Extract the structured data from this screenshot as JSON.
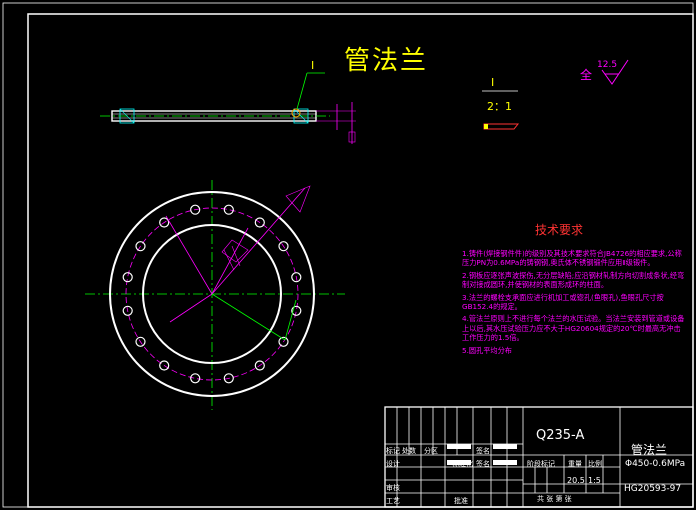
{
  "drawing": {
    "title": "管法兰",
    "detail_callout": "I",
    "detail_label": "I",
    "detail_scale": "2：1",
    "roughness_prefix": "全",
    "roughness_value": "12.5"
  },
  "tech_requirements": {
    "title": "技术要求",
    "items": [
      "1.铸件(焊接钢件件)的级别及其技术要求符合JB4726的相应要求,公称压力PN为0.6MPa的铸钢钢,奥氏体不锈钢锻件应用Ⅱ级锻件。",
      "2.钢板应逐张声波探伤,无分层缺陷;应沿钢材轧制方向切割成条状,经弯制对接成圆环,并使钢材的表面形成环的柱面。",
      "3.法兰的螺栓支承面应进行机加工或锪孔(鱼眼孔),鱼眼孔尺寸按GB152.4的规定。",
      "4.管法兰原则上不进行每个法兰的水压试验。当法兰安装到管道或设备上以后,其水压试验压力应不大于HG20604规定的20℃时最高无冲击工作压力的1.5倍。",
      "5.圆孔平均分布"
    ]
  },
  "title_block": {
    "material": "Q235-A",
    "part_name": "管法兰",
    "spec": "Φ450-0.6MPa",
    "standard_no": "HG20593-97",
    "row_labels": {
      "mark": "标记",
      "count": "处数",
      "zone": "分区",
      "sign": "签名",
      "design": "设计",
      "standardize": "标准化",
      "sign2": "签名",
      "check": "审核",
      "craft": "工艺",
      "approve": "批准"
    },
    "stage_mark": "阶段标记",
    "weight_label": "重量",
    "scale_label": "比例",
    "weight": "20.5",
    "scale": "1:5",
    "sheets": "共  张  第  张"
  }
}
